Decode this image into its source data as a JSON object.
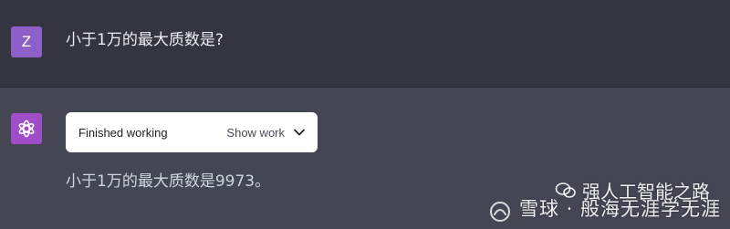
{
  "colors": {
    "user_avatar_bg": "#8e5fc8",
    "bot_avatar_bg": "#a04ec8"
  },
  "user_message": {
    "avatar_letter": "Z",
    "text": "小于1万的最大质数是?"
  },
  "assistant_message": {
    "avatar_icon": "openai-logo-icon",
    "work_panel": {
      "status": "Finished working",
      "toggle_label": "Show work",
      "toggle_icon": "chevron-down-icon"
    },
    "text": "小于1万的最大质数是9973。"
  },
  "watermark": {
    "source_icon": "snowball-logo-icon",
    "source_text": "雪球 · 般海无涯学无涯",
    "wechat_icon": "wechat-icon",
    "wechat_text": "强人工智能之路"
  }
}
